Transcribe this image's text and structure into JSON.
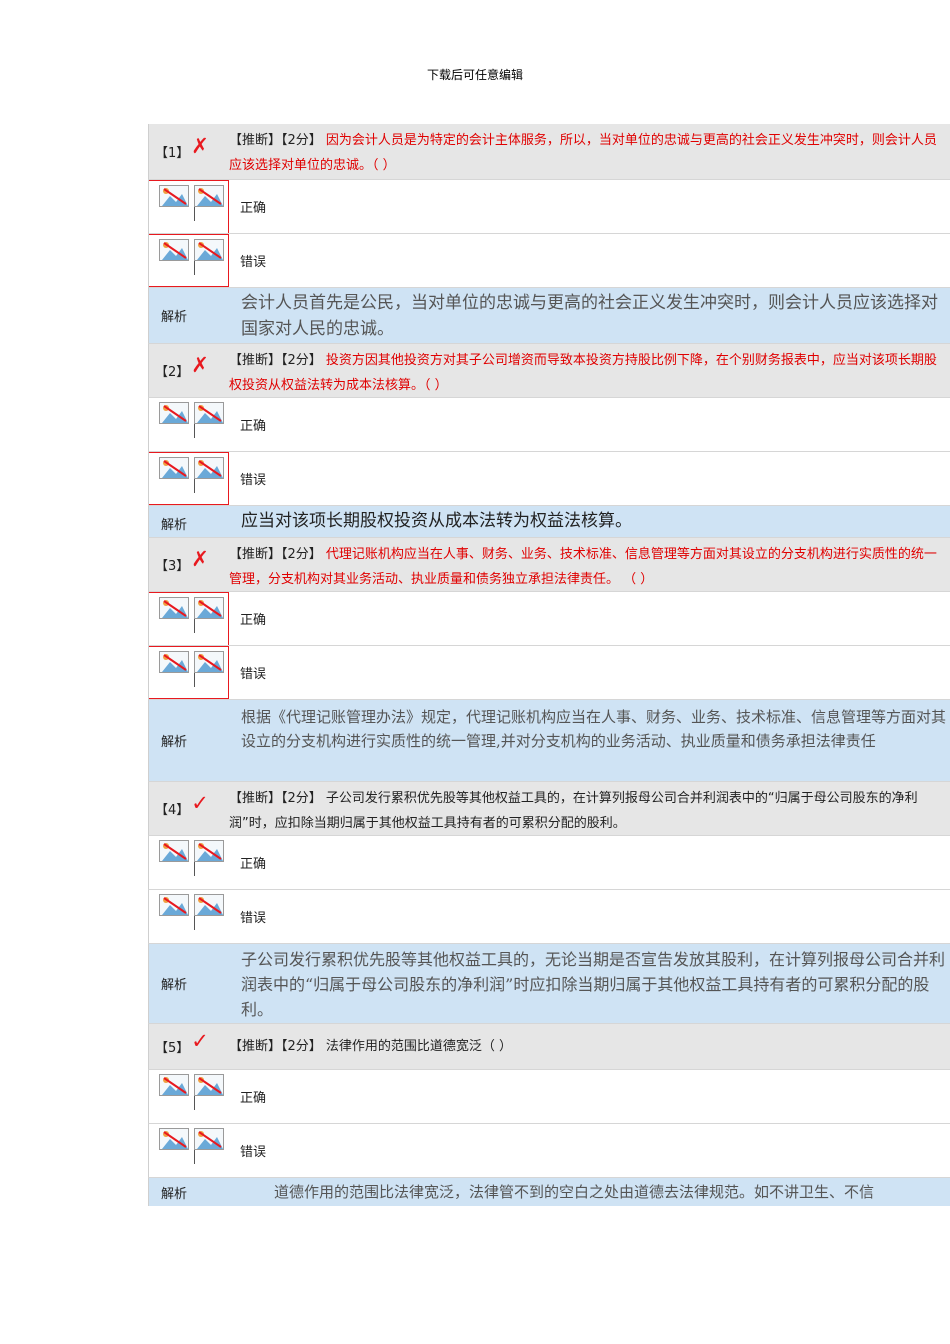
{
  "header": "下载后可任意编辑",
  "questions": [
    {
      "num": "【1】",
      "mark": "✗",
      "tag": "【推断】【2分】",
      "text": "因为会计人员是为特定的会计主体服务，所以，当对单位的忠诚与更高的社会正义发生冲突时，则会计人员应该选择对单位的忠诚。（ ）",
      "option_true": "正确",
      "option_false": "错误",
      "explanation_label": "解析",
      "explanation": "会计人员首先是公民，当对单位的忠诚与更高的社会正义发生冲突时，则会计人员应该选择对国家对人民的忠诚。"
    },
    {
      "num": "【2】",
      "mark": "✗",
      "tag": "【推断】【2分】",
      "text": "投资方因其他投资方对其子公司增资而导致本投资方持股比例下降，在个别财务报表中，应当对该项长期股权投资从权益法转为成本法核算。（ ）",
      "option_true": "正确",
      "option_false": "错误",
      "explanation_label": "解析",
      "explanation": "应当对该项长期股权投资从成本法转为权益法核算。"
    },
    {
      "num": "【3】",
      "mark": "✗",
      "tag": "【推断】【2分】",
      "text": "代理记账机构应当在人事、财务、业务、技术标准、信息管理等方面对其设立的分支机构进行实质性的统一管理，分支机构对其业务活动、执业质量和债务独立承担法律责任。 （ ）",
      "option_true": "正确",
      "option_false": "错误",
      "explanation_label": "解析",
      "explanation": "根据《代理记账管理办法》规定，代理记账机构应当在人事、财务、业务、技术标准、信息管理等方面对其设立的分支机构进行实质性的统一管理,并对分支机构的业务活动、执业质量和债务承担法律责任"
    },
    {
      "num": "【4】",
      "mark": "✓",
      "tag": "【推断】【2分】",
      "text": "子公司发行累积优先股等其他权益工具的，在计算列报母公司合并利润表中的“归属于母公司股东的净利润”时，应扣除当期归属于其他权益工具持有者的可累积分配的股利。",
      "option_true": "正确",
      "option_false": "错误",
      "explanation_label": "解析",
      "explanation": "子公司发行累积优先股等其他权益工具的，无论当期是否宣告发放其股利，在计算列报母公司合并利润表中的“归属于母公司股东的净利润”时应扣除当期归属于其他权益工具持有者的可累积分配的股利。"
    },
    {
      "num": "【5】",
      "mark": "✓",
      "tag": "【推断】【2分】",
      "text": "法律作用的范围比道德宽泛（ ）",
      "option_true": "正确",
      "option_false": "错误",
      "explanation_label": "解析",
      "explanation": "道德作用的范围比法律宽泛，法律管不到的空白之处由道德去法律规范。如不讲卫生、不信"
    }
  ]
}
